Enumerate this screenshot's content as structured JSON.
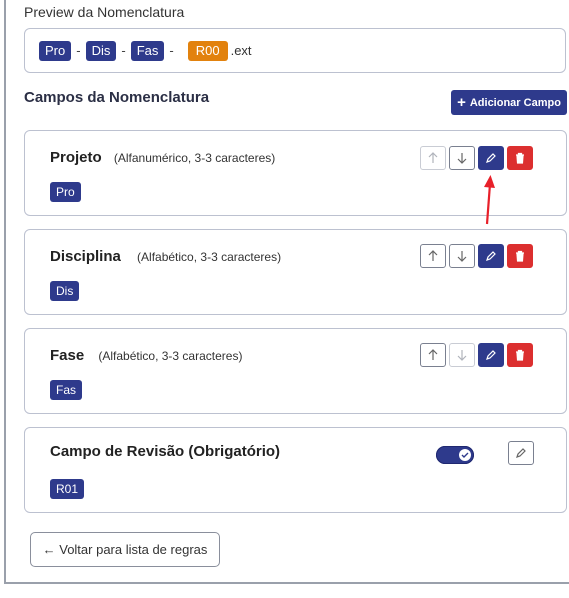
{
  "preview": {
    "label": "Preview da Nomenclatura",
    "tokens": [
      "Pro",
      "Dis",
      "Fas"
    ],
    "separator": "-",
    "revision_token": "R00",
    "extension": ".ext"
  },
  "section": {
    "title": "Campos da Nomenclatura",
    "add_button_icon": "+",
    "add_button_label": "Adicionar Campo"
  },
  "fields": [
    {
      "name": "Projeto",
      "description": "(Alfanumérico, 3-3 caracteres)",
      "code": "Pro"
    },
    {
      "name": "Disciplina",
      "description": "(Alfabético, 3-3 caracteres)",
      "code": "Dis"
    },
    {
      "name": "Fase",
      "description": "(Alfabético, 3-3 caracteres)",
      "code": "Fas"
    }
  ],
  "revision_field": {
    "name": "Campo de Revisão (Obrigatório)",
    "code": "R01",
    "toggle_on": true
  },
  "icons": {
    "up": "arrow-up-icon",
    "down": "arrow-down-icon",
    "edit": "pencil-icon",
    "delete": "trash-icon",
    "check": "check-icon"
  },
  "colors": {
    "primary": "#2e3a8c",
    "danger": "#dc2f2f",
    "revision": "#e2820e",
    "annotation": "#e8202a"
  },
  "back_button": {
    "label": "← Voltar para lista de regras"
  }
}
